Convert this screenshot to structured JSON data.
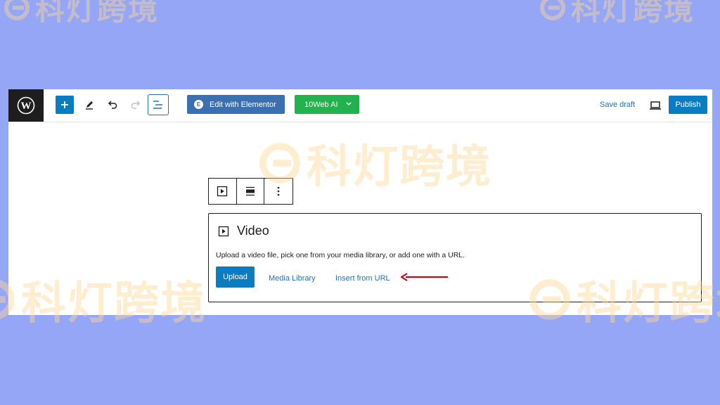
{
  "watermark": {
    "text": "科灯跨境"
  },
  "colors": {
    "background": "#94a6f5",
    "accent_blue": "#0a7cc0",
    "elementor_blue": "#3a6fb0",
    "tenweb_green": "#22b14c",
    "link_blue": "#2271b1",
    "annotation_red": "#d0021b",
    "watermark": "#ffd696"
  },
  "toolbar": {
    "logo_icon": "wordpress-logo",
    "add_icon": "plus-icon",
    "tools_icon": "pencil-icon",
    "undo_icon": "undo-icon",
    "redo_icon": "redo-icon",
    "list_view_icon": "list-view-icon",
    "elementor_label": "Edit with Elementor",
    "tenweb_label": "10Web AI",
    "save_draft_label": "Save draft",
    "preview_icon": "laptop-icon",
    "publish_label": "Publish"
  },
  "block_toolbar": {
    "items": [
      "video-block-icon",
      "align-icon",
      "more-options-icon"
    ]
  },
  "video_block": {
    "title": "Video",
    "instructions": "Upload a video file, pick one from your media library, or add one with a URL.",
    "upload_label": "Upload",
    "media_library_label": "Media Library",
    "insert_url_label": "Insert from URL"
  }
}
